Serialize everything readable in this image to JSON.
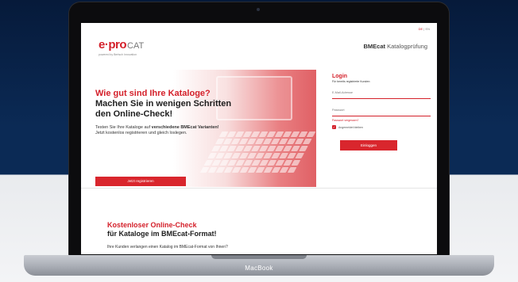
{
  "device": {
    "label": "MacBook"
  },
  "site": {
    "lang": {
      "de": "DE",
      "sep": "|",
      "en": "EN"
    },
    "logo": {
      "main": "e·pro",
      "cat": "CAT",
      "sub": "powered by Bertsch Innovation"
    },
    "brand_right": {
      "bold": "BMEcat",
      "rest": " Katalogprüfung"
    }
  },
  "hero": {
    "line1": "Wie gut sind Ihre Kataloge?",
    "line2": "Machen Sie in wenigen Schritten",
    "line3": "den Online-Check!",
    "body_pre": "Testen Sie Ihre Kataloge auf ",
    "body_bold": "verschiedene BMEcat Varianten!",
    "body_line2": "Jetzt kostenlos registrieren und gleich loslegen.",
    "register_label": "Jetzt registrieren"
  },
  "login": {
    "title": "Login",
    "subtitle": "Für bereits registrierte Kunden:",
    "email_label": "E-Mail-Adresse",
    "password_label": "Passwort",
    "forgot_label": "Passwort vergessen?",
    "remember_label": "Angemeldet bleiben",
    "submit_label": "Einloggen",
    "remember_checked": true
  },
  "section2": {
    "line1": "Kostenloser Online-Check",
    "line2": "für Kataloge im BMEcat-Format!",
    "body": "Ihre Kunden verlangen einen Katalog im BMEcat-Format von Ihnen?"
  },
  "colors": {
    "accent": "#d4202a",
    "dark_bg": "#0b2a55"
  }
}
